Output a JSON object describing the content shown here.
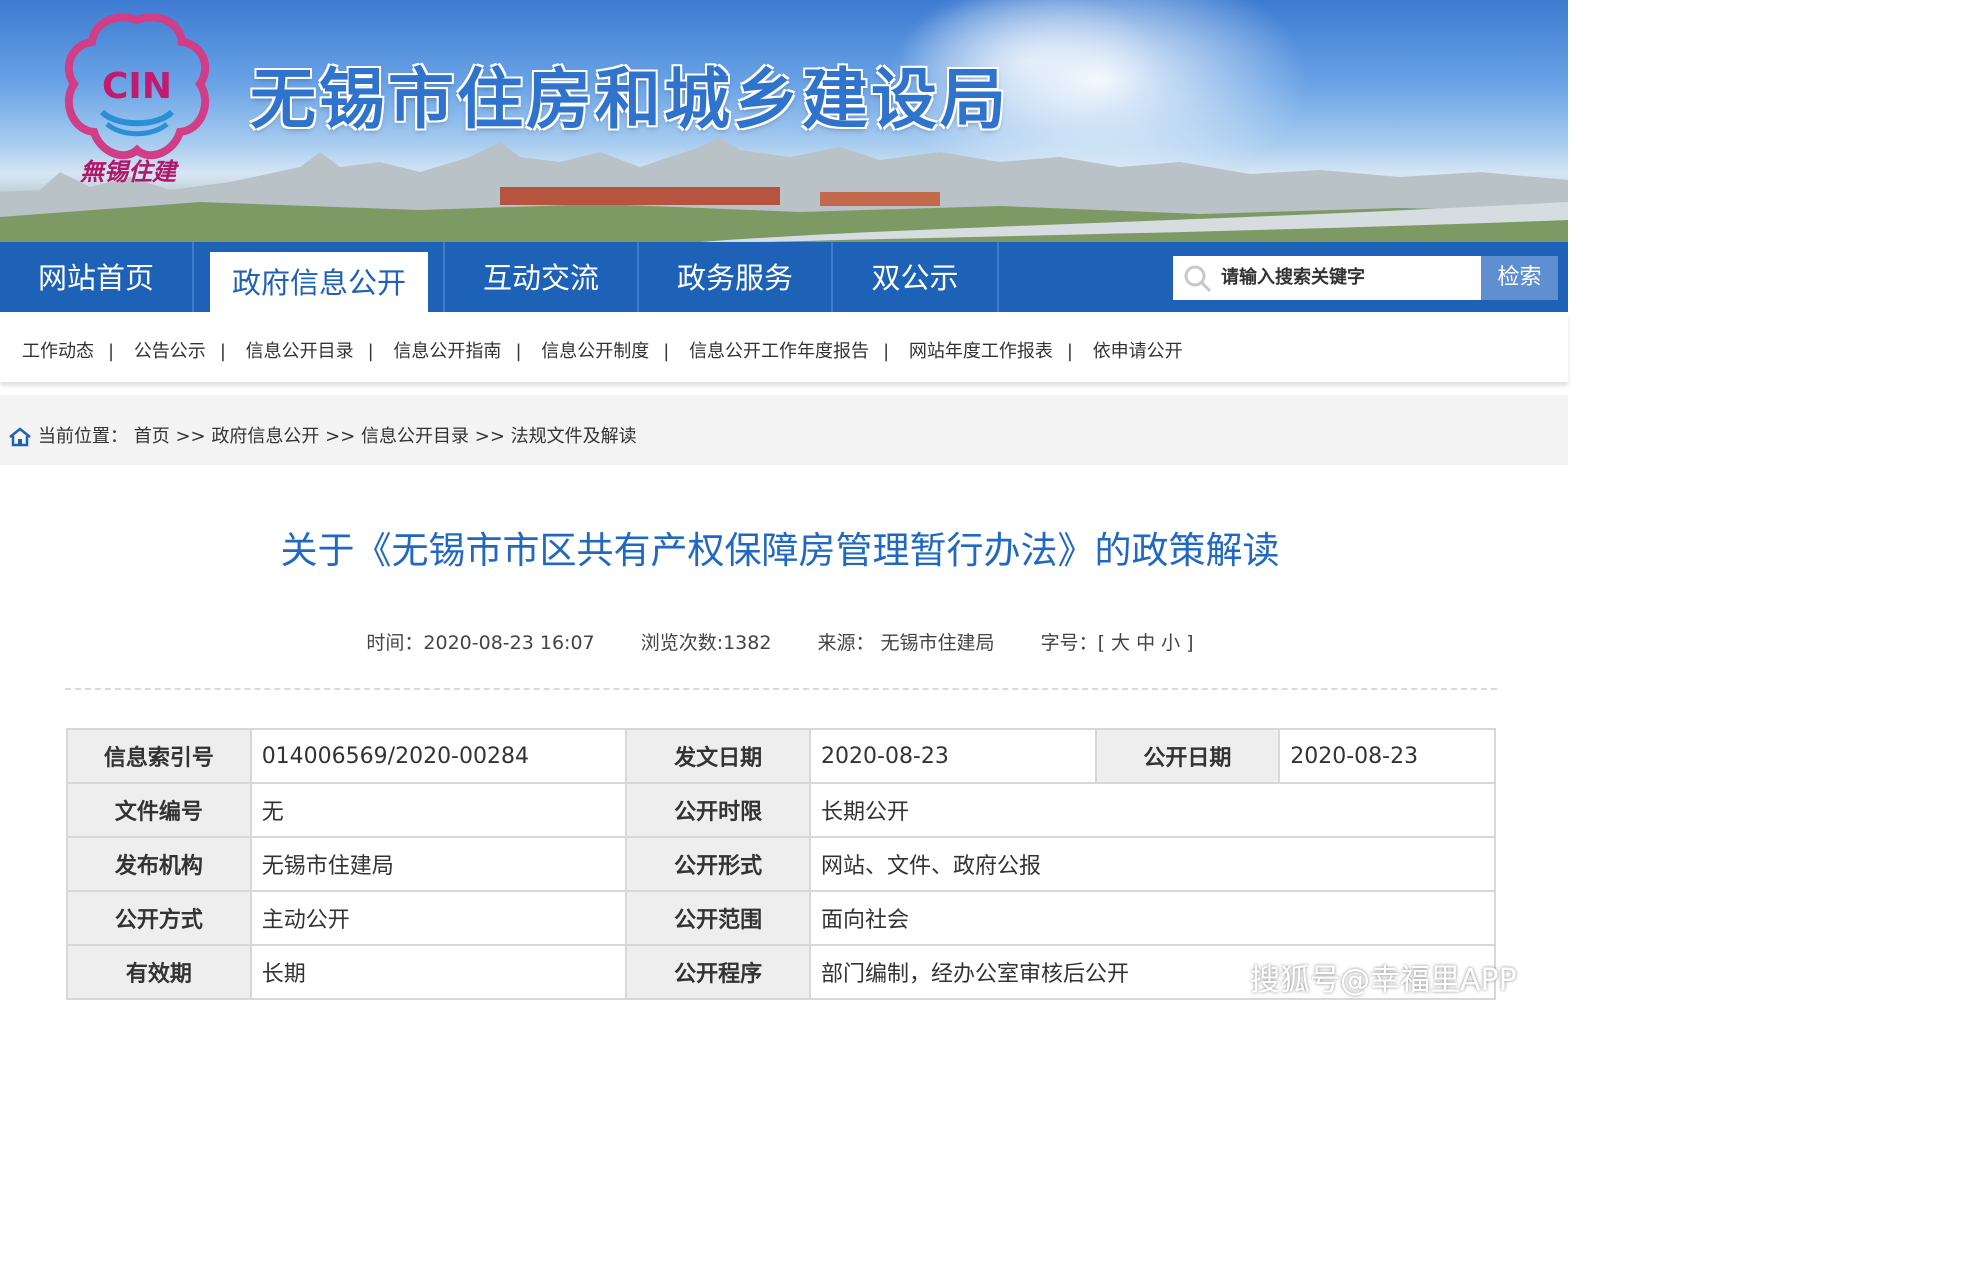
{
  "header": {
    "site_title": "无锡市住房和城乡建设局",
    "logo_text": "CIN",
    "logo_caption": "無锡住建"
  },
  "mainnav": {
    "items": [
      {
        "label": "网站首页"
      },
      {
        "label": "政府信息公开",
        "active": true
      },
      {
        "label": "互动交流"
      },
      {
        "label": "政务服务"
      },
      {
        "label": "双公示"
      }
    ],
    "search_placeholder": "请输入搜索关键字",
    "search_button": "检索"
  },
  "subnav": {
    "items": [
      "工作动态",
      "公告公示",
      "信息公开目录",
      "信息公开指南",
      "信息公开制度",
      "信息公开工作年度报告",
      "网站年度工作报表",
      "依申请公开"
    ],
    "separator": "|"
  },
  "breadcrumb": {
    "prefix": "当前位置：",
    "items": [
      "首页",
      "政府信息公开",
      "信息公开目录",
      "法规文件及解读"
    ],
    "separator": ">>"
  },
  "article": {
    "title": "关于《无锡市市区共有产权保障房管理暂行办法》的政策解读",
    "time": "时间：2020-08-23 16:07",
    "views": "浏览次数:1382",
    "source": "来源：  无锡市住建局",
    "font_size": "字号：[ 大 中 小 ]"
  },
  "info_table": {
    "row1": {
      "k1": "信息索引号",
      "v1": "014006569/2020-00284",
      "k2": "发文日期",
      "v2": "2020-08-23",
      "k3": "公开日期",
      "v3": "2020-08-23"
    },
    "row2": {
      "k1": "文件编号",
      "v1": "无",
      "k2": "公开时限",
      "v2": "长期公开"
    },
    "row3": {
      "k1": "发布机构",
      "v1": "无锡市住建局",
      "k2": "公开形式",
      "v2": "网站、文件、政府公报"
    },
    "row4": {
      "k1": "公开方式",
      "v1": "主动公开",
      "k2": "公开范围",
      "v2": "面向社会"
    },
    "row5": {
      "k1": "有效期",
      "v1": "长期",
      "k2": "公开程序",
      "v2": "部门编制，经办公室审核后公开"
    }
  },
  "watermark": "搜狐号@幸福里APP",
  "colors": {
    "brand_blue": "#1d62b6",
    "title_blue": "#2168c2",
    "search_btn": "#5f8fd0"
  }
}
